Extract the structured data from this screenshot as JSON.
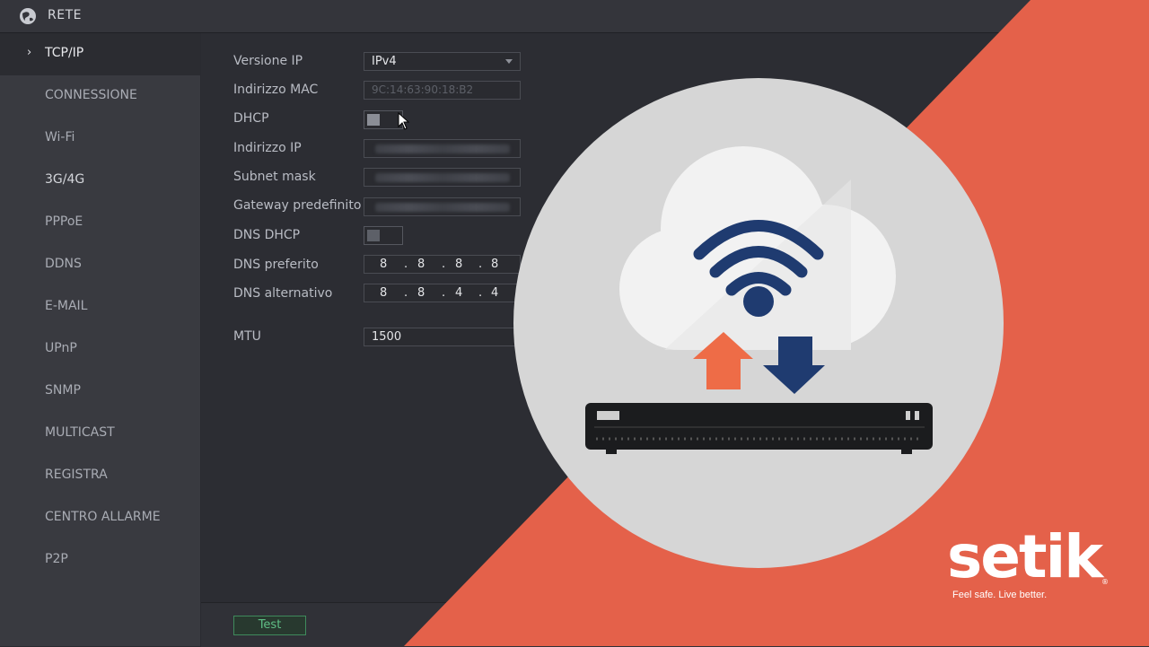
{
  "header": {
    "title": "RETE",
    "icon": "globe-icon"
  },
  "sidebar": {
    "items": [
      {
        "label": "TCP/IP",
        "active": true
      },
      {
        "label": "CONNESSIONE"
      },
      {
        "label": "Wi-Fi"
      },
      {
        "label": "3G/4G"
      },
      {
        "label": "PPPoE"
      },
      {
        "label": "DDNS"
      },
      {
        "label": "E-MAIL"
      },
      {
        "label": "UPnP"
      },
      {
        "label": "SNMP"
      },
      {
        "label": "MULTICAST"
      },
      {
        "label": "REGISTRA"
      },
      {
        "label": "CENTRO ALLARME"
      },
      {
        "label": "P2P"
      }
    ],
    "active_marker": "›"
  },
  "form": {
    "ip_version": {
      "label": "Versione IP",
      "value": "IPv4"
    },
    "mac": {
      "label": "Indirizzo MAC",
      "value": "9C:14:63:90:18:B2"
    },
    "dhcp": {
      "label": "DHCP",
      "enabled": false
    },
    "ip_address": {
      "label": "Indirizzo IP"
    },
    "subnet": {
      "label": "Subnet mask"
    },
    "gateway": {
      "label": "Gateway predefinito"
    },
    "dns_dhcp": {
      "label": "DNS DHCP",
      "enabled": false
    },
    "dns_preferred": {
      "label": "DNS preferito",
      "octets": [
        "8",
        "8",
        "8",
        "8"
      ]
    },
    "dns_alternate": {
      "label": "DNS alternativo",
      "octets": [
        "8",
        "8",
        "4",
        "4"
      ]
    },
    "mtu": {
      "label": "MTU",
      "value": "1500"
    }
  },
  "footer": {
    "test_label": "Test"
  },
  "overlay": {
    "brand": "setik",
    "registered_mark": "®",
    "slogan": "Feel safe. Live better.",
    "colors": {
      "accent_orange": "#e4614a",
      "circle": "#d6d6d6",
      "cloud": "#f2f2f2",
      "navy": "#1f3b70",
      "arrow_up": "#ee6c47"
    }
  }
}
